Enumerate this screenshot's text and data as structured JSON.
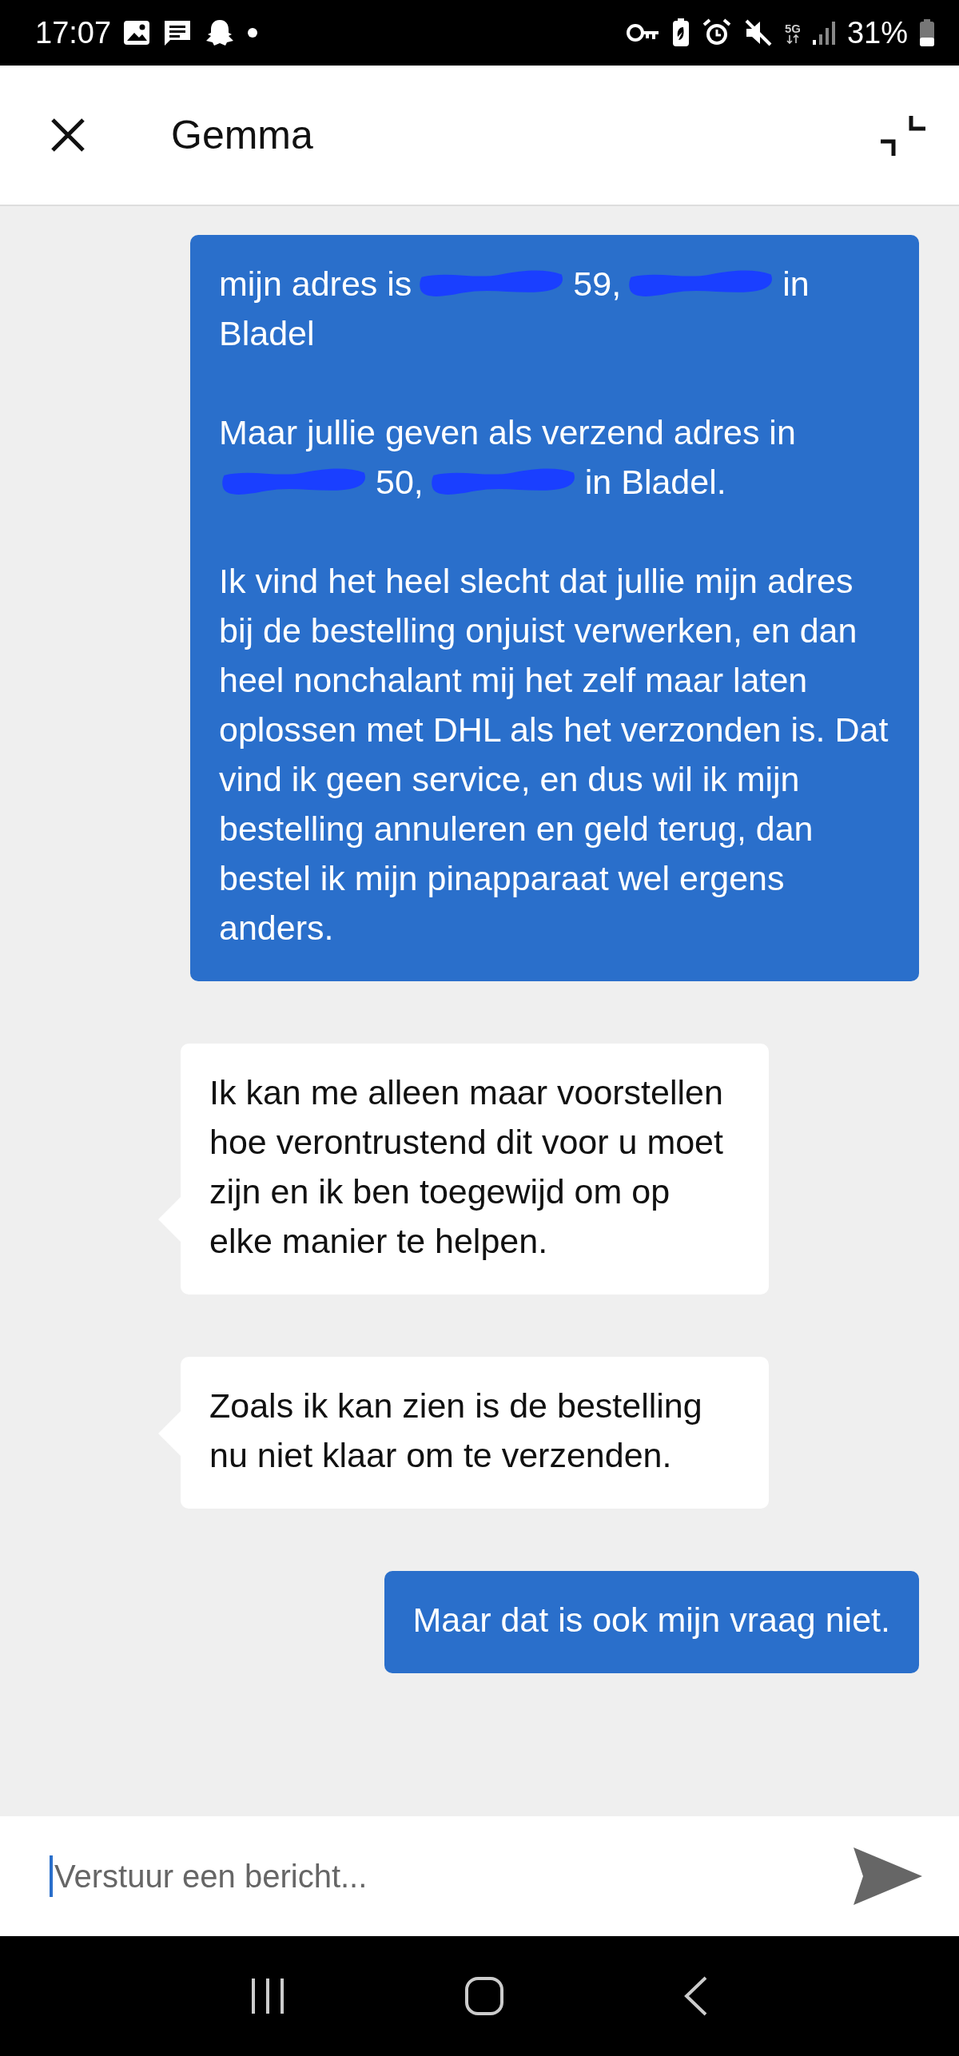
{
  "status_bar": {
    "time": "17:07",
    "network": "5G",
    "battery": "31%"
  },
  "header": {
    "title": "Gemma"
  },
  "messages": [
    {
      "kind": "sent",
      "paragraphs": [
        [
          [
            {
              "kind": "text",
              "text": "mijn adres is"
            },
            {
              "kind": "redaction"
            },
            {
              "kind": "text",
              "text": "59,"
            },
            {
              "kind": "redaction"
            },
            {
              "kind": "text",
              "text": "in"
            }
          ],
          [
            {
              "kind": "text",
              "text": "Bladel"
            }
          ]
        ],
        [
          [
            {
              "kind": "text",
              "text": "Maar jullie geven als verzend adres in"
            }
          ],
          [
            {
              "kind": "redaction"
            },
            {
              "kind": "text",
              "text": "50,"
            },
            {
              "kind": "redaction"
            },
            {
              "kind": "text",
              "text": "in Bladel."
            }
          ]
        ]
      ],
      "text": "Ik vind het heel slecht dat jullie mijn adres bij de bestelling onjuist verwerken, en dan heel nonchalant mij het zelf maar laten oplossen met DHL als het verzonden is. Dat vind ik geen service, en dus wil ik mijn bestelling annuleren en geld terug, dan bestel ik mijn pinapparaat wel ergens anders."
    },
    {
      "kind": "received",
      "text": "Ik kan me alleen maar voorstellen hoe verontrustend dit voor u moet zijn en ik ben toegewijd om op elke manier te helpen."
    },
    {
      "kind": "received",
      "text": "Zoals ik kan zien is de bestelling nu niet klaar om te verzenden."
    },
    {
      "kind": "sent",
      "text": "Maar dat is ook mijn vraag niet."
    }
  ],
  "composer": {
    "placeholder": "Verstuur een bericht..."
  }
}
